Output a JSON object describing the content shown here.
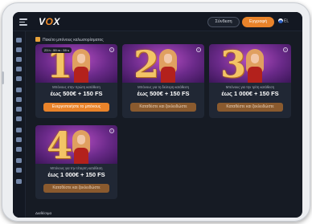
{
  "header": {
    "logo_prefix": "V",
    "logo_o": "O",
    "logo_suffix": "X",
    "login_label": "Σύνδεση",
    "register_label": "Εγγραφή",
    "language": "EL"
  },
  "sidebar": {
    "icons": [
      "home-icon",
      "slot-icon",
      "casino-icon",
      "live-icon",
      "promo-icon",
      "games-icon",
      "cards-icon",
      "sport-icon",
      "chat-icon",
      "payments-icon",
      "vip-icon",
      "tournament-icon",
      "info-icon",
      "support-icon",
      "settings-icon"
    ]
  },
  "breadcrumb": {
    "label": "Πακέτο μπόνους καλωσορίσματος"
  },
  "cards": [
    {
      "number": "1",
      "timer": "23 h : 59 m : 59 s",
      "description": "Μπόνους στην πρώτη κατάθεση",
      "amount": "έως 500€ + 150 FS",
      "button": "Ενεργοποιήστε το μπόνους"
    },
    {
      "number": "2",
      "description": "Μπόνους για τη δεύτερη κατάθεση",
      "amount": "έως 500€ + 150 FS",
      "button": "Καταθέστε και ξεκλειδώστε"
    },
    {
      "number": "3",
      "description": "Μπόνους για την τρίτη κατάθεση",
      "amount": "έως 1 000€ + 150 FS",
      "button": "Καταθέστε και ξεκλειδώστε"
    },
    {
      "number": "4",
      "description": "Μπόνους για την τέταρτη κατάθεση",
      "amount": "έως 1 000€ + 150 FS",
      "button": "Καταθέστε και ξεκλειδώστε"
    }
  ],
  "footer": {
    "label": "Διαθέσιμα"
  },
  "colors": {
    "accent": "#e9832a",
    "background": "#161b24",
    "card": "#202734"
  }
}
